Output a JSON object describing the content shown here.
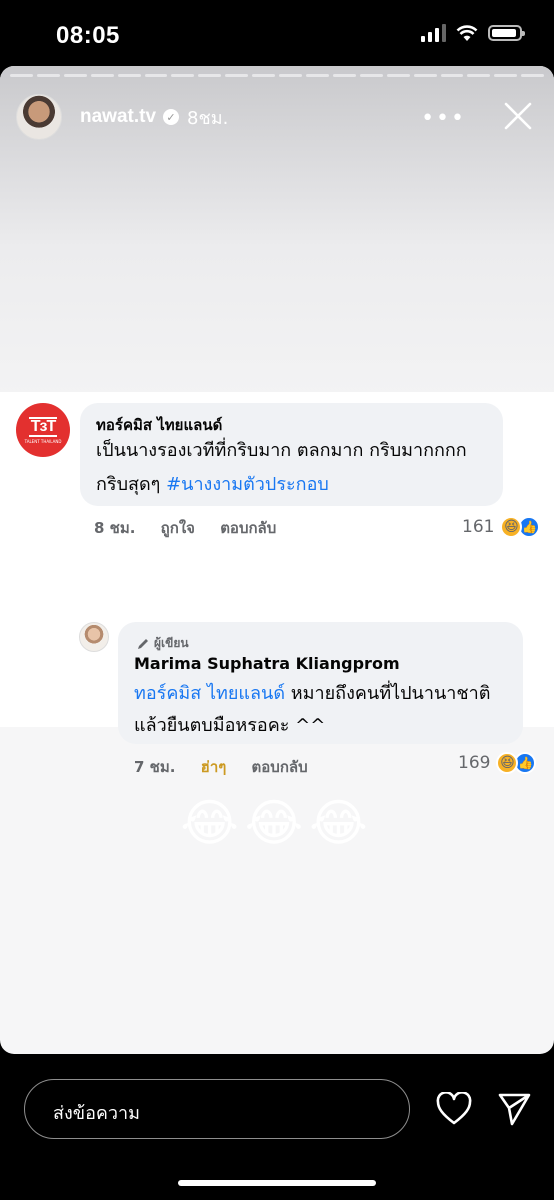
{
  "status_bar": {
    "time": "08:05"
  },
  "story": {
    "username": "nawat.tv",
    "time_ago": "8ชม.",
    "more_label": "•••",
    "progress_segments": 20
  },
  "comment": {
    "page_name": "ทอร์คมิส ไทยแลนด์",
    "text_line1": "เป็นนางรองเวทีที่กริบมาก ตลกมาก กริบมากกกก",
    "text_line2": "กริบสุดๆ ",
    "hashtag": "#นางงามตัวประกอบ",
    "time": "8 ชม.",
    "like_label": "ถูกใจ",
    "reply_label": "ตอบกลับ",
    "reaction_count": "161"
  },
  "reply": {
    "author_badge": "ผู้เขียน",
    "name": "Marima Suphatra Kliangprom",
    "mention": "ทอร์คมิส ไทยแลนด์",
    "text_line1_rest": " หมายถึงคนที่ไปนานาชาติ",
    "text_line2": "แล้วยืนตบมือหรอคะ ^^",
    "time": "7 ชม.",
    "reaction_label": "ฮ่าๆ",
    "reply_label": "ตอบกลับ",
    "reaction_count": "169"
  },
  "emojis": "😂😂😂",
  "footer": {
    "message_placeholder": "ส่งข้อความ"
  },
  "colors": {
    "fb_link": "#1877f2",
    "haha_orange": "#f7b125",
    "brand_red": "#e3302f"
  }
}
